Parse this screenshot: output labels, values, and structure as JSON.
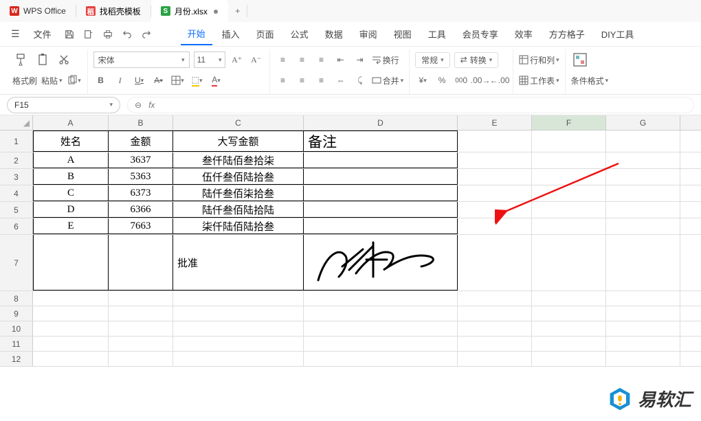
{
  "titlebar": {
    "app_name": "WPS Office",
    "tab2": "找稻壳模板",
    "tab3": "月份.xlsx",
    "add": "+"
  },
  "menu": {
    "file": "文件",
    "items": [
      "开始",
      "插入",
      "页面",
      "公式",
      "数据",
      "审阅",
      "视图",
      "工具",
      "会员专享",
      "效率",
      "方方格子",
      "DIY工具"
    ]
  },
  "ribbon": {
    "format_painter": "格式刷",
    "paste": "粘贴",
    "font_name": "宋体",
    "font_size": "11",
    "wrap": "换行",
    "merge": "合并",
    "normal": "常规",
    "transform": "转换",
    "rowcol": "行和列",
    "worksheet": "工作表",
    "cond_fmt": "条件格式"
  },
  "namebox": {
    "ref": "F15"
  },
  "formulabar": {
    "fx": "fx"
  },
  "columns": [
    "A",
    "B",
    "C",
    "D",
    "E",
    "F",
    "G"
  ],
  "table": {
    "headers": {
      "name": "姓名",
      "amount": "金额",
      "cn_amount": "大写金额",
      "note": "备注"
    },
    "rows": [
      {
        "name": "A",
        "amount": "3637",
        "cn": "叁仟陆佰叁拾柒"
      },
      {
        "name": "B",
        "amount": "5363",
        "cn": "伍仟叁佰陆拾叁"
      },
      {
        "name": "C",
        "amount": "6373",
        "cn": "陆仟叁佰柒拾叁"
      },
      {
        "name": "D",
        "amount": "6366",
        "cn": "陆仟叁佰陆拾陆"
      },
      {
        "name": "E",
        "amount": "7663",
        "cn": "柒仟陆佰陆拾叁"
      }
    ],
    "approve": "批准"
  },
  "watermark": "易软汇"
}
